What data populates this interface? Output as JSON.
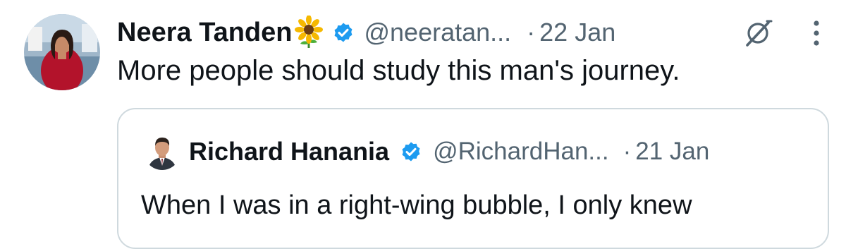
{
  "tweet": {
    "author_name": "Neera Tanden",
    "author_emoji": "sunflower",
    "handle": "@neeratan...",
    "separator": "·",
    "date": "22 Jan",
    "text": "More people should study this man's journey.",
    "verified_color": "#1d9bf0"
  },
  "quote": {
    "author_name": "Richard Hanania",
    "handle": "@RichardHan...",
    "separator": "·",
    "date": "21 Jan",
    "text": "When I was in a right-wing bubble, I only knew"
  },
  "icons": {
    "grok": "grok-icon",
    "more": "more-icon",
    "verified": "verified-badge-icon"
  },
  "colors": {
    "secondary_text": "#536471",
    "primary_text": "#0f1419",
    "border": "#cfd9de"
  }
}
